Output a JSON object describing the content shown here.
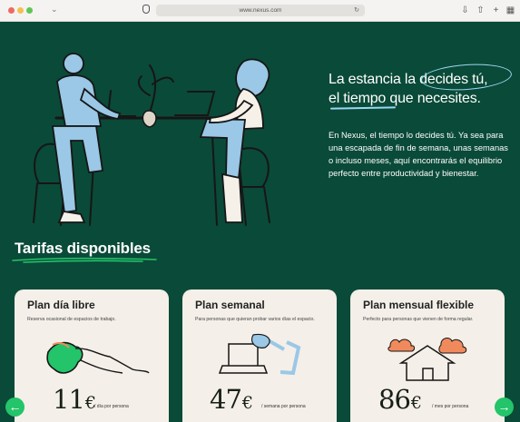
{
  "browser": {
    "url": "www.nexus.com"
  },
  "hero": {
    "headline_line1": "La estancia la decides tú,",
    "headline_line2": "el tiempo que necesites.",
    "intro": "En Nexus, el tiempo lo decides tú. Ya sea para una escapada de fin de semana, unas semanas o incluso meses, aquí encontrarás el equilibrio perfecto entre productividad y bienestar."
  },
  "section": {
    "title": "Tarifas disponibles"
  },
  "plans": [
    {
      "title": "Plan día libre",
      "description": "Reserva ocasional de espacios de trabajo.",
      "price": "11",
      "currency": "€",
      "unit": "/ día por persona"
    },
    {
      "title": "Plan semanal",
      "description": "Para personas que quieran probar varios días el espacio.",
      "price": "47",
      "currency": "€",
      "unit": "/ semana por persona"
    },
    {
      "title": "Plan mensual flexible",
      "description": "Perfecto para personas que vienen de forma regular.",
      "price": "86",
      "currency": "€",
      "unit": "/ mes por persona"
    }
  ],
  "controls": {
    "prev_icon": "arrow-left-icon",
    "next_icon": "arrow-right-icon"
  },
  "colors": {
    "background": "#0a4a38",
    "accent": "#23c46a",
    "highlight": "#9ad6f4",
    "card": "#f4efe8"
  }
}
